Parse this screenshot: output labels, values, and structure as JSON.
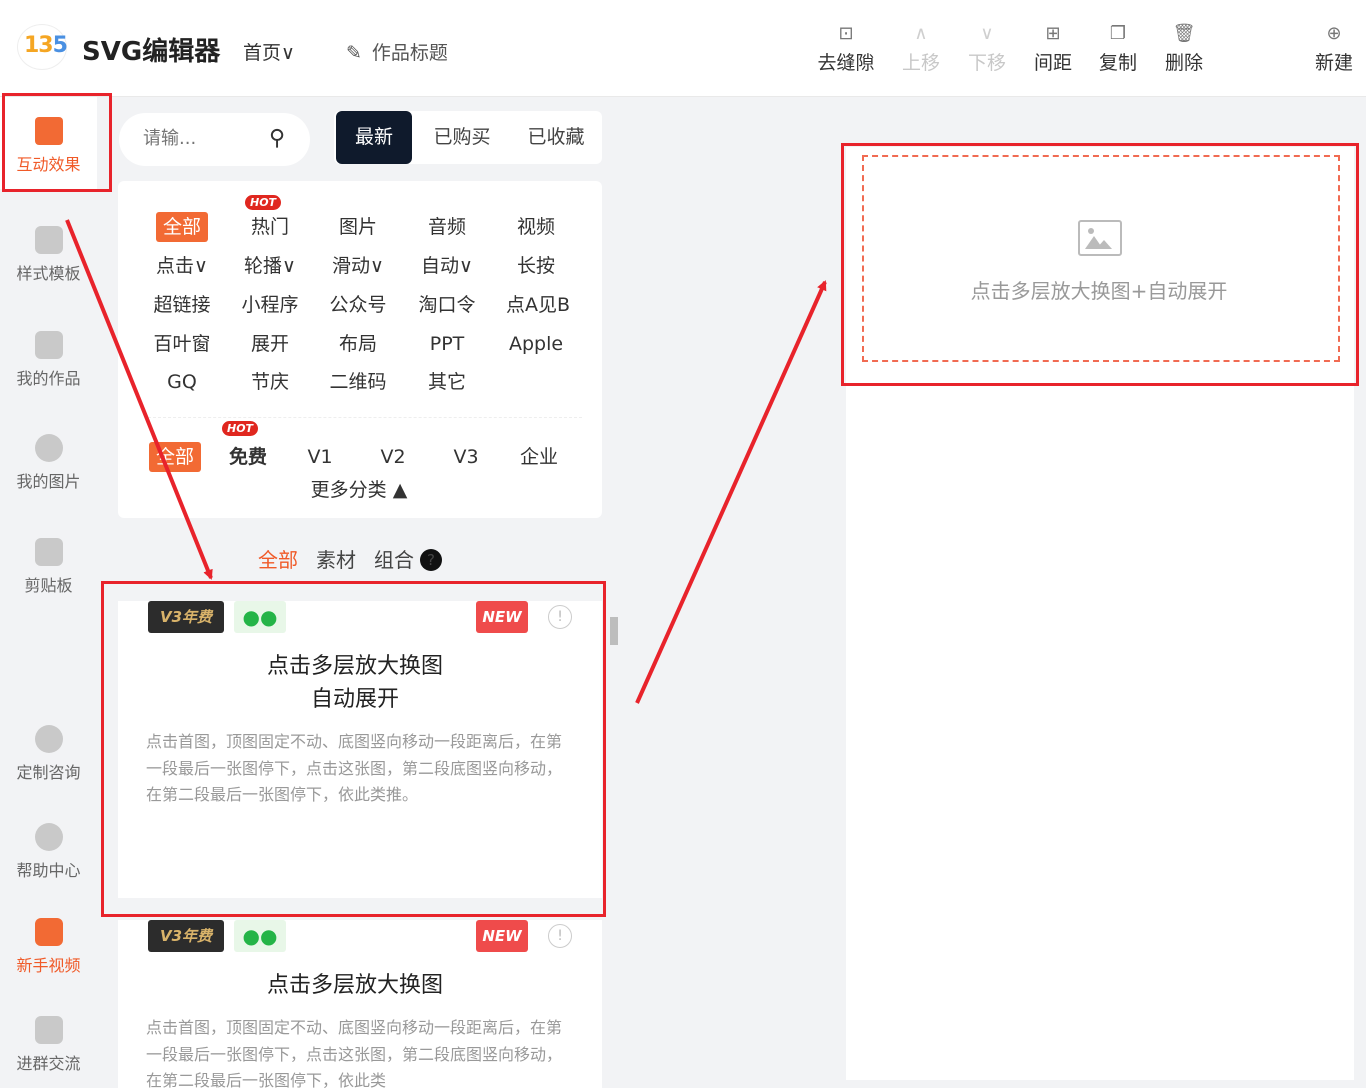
{
  "header": {
    "logo_mark_1": "13",
    "logo_mark_2": "5",
    "app_name": "SVG编辑器",
    "home_menu": "首页",
    "work_title": "作品标题",
    "tools": [
      {
        "label": "去缝隙",
        "icon": "gap-icon",
        "enabled": true
      },
      {
        "label": "上移",
        "icon": "chevron-up-icon",
        "enabled": false
      },
      {
        "label": "下移",
        "icon": "chevron-down-icon",
        "enabled": false
      },
      {
        "label": "间距",
        "icon": "spacing-icon",
        "enabled": true
      },
      {
        "label": "复制",
        "icon": "copy-icon",
        "enabled": true
      },
      {
        "label": "删除",
        "icon": "trash-icon",
        "enabled": true
      },
      {
        "label": "新建",
        "icon": "new-file-icon",
        "enabled": true
      }
    ]
  },
  "sidebar": {
    "items": [
      {
        "label": "互动效果",
        "active": true
      },
      {
        "label": "样式模板"
      },
      {
        "label": "我的作品"
      },
      {
        "label": "我的图片"
      },
      {
        "label": "剪贴板"
      },
      {
        "label": "定制咨询"
      },
      {
        "label": "帮助中心"
      },
      {
        "label": "新手视频"
      },
      {
        "label": "进群交流"
      }
    ]
  },
  "search": {
    "placeholder": "请输..."
  },
  "tabs": [
    "最新",
    "已购买",
    "已收藏"
  ],
  "categories": {
    "hot_badge": "HOT",
    "rows": [
      [
        "全部",
        "热门",
        "图片",
        "音频",
        "视频"
      ],
      [
        "点击",
        "轮播",
        "滑动",
        "自动",
        "长按"
      ],
      [
        "超链接",
        "小程序",
        "公众号",
        "淘口令",
        "点A见B"
      ],
      [
        "百叶窗",
        "展开",
        "布局",
        "PPT",
        "Apple"
      ],
      [
        "GQ",
        "节庆",
        "二维码",
        "其它"
      ]
    ],
    "dropdown_mark": "∨"
  },
  "tiers": [
    "全部",
    "免费",
    "V1",
    "V2",
    "V3",
    "企业"
  ],
  "more_categories": "更多分类 ▲",
  "sub_tabs": [
    "全部",
    "素材",
    "组合"
  ],
  "help_mark": "?",
  "cards": [
    {
      "badge_tier": "V3年费",
      "badge_new": "NEW",
      "title_line1": "点击多层放大换图",
      "title_line2": "自动展开",
      "description": "点击首图，顶图固定不动、底图竖向移动一段距离后，在第一段最后一张图停下，点击这张图，第二段底图竖向移动，在第二段最后一张图停下，依此类推。"
    },
    {
      "badge_tier": "V3年费",
      "badge_new": "NEW",
      "title_line1": "点击多层放大换图",
      "description": "点击首图，顶图固定不动、底图竖向移动一段距离后，在第一段最后一张图停下，点击这张图，第二段底图竖向移动，在第二段最后一张图停下，依此类"
    }
  ],
  "canvas": {
    "placeholder_text": "点击多层放大换图+自动展开"
  },
  "colors": {
    "accent": "#f26a34",
    "annotation": "#e8232b",
    "tab_active": "#0f1a2c"
  }
}
